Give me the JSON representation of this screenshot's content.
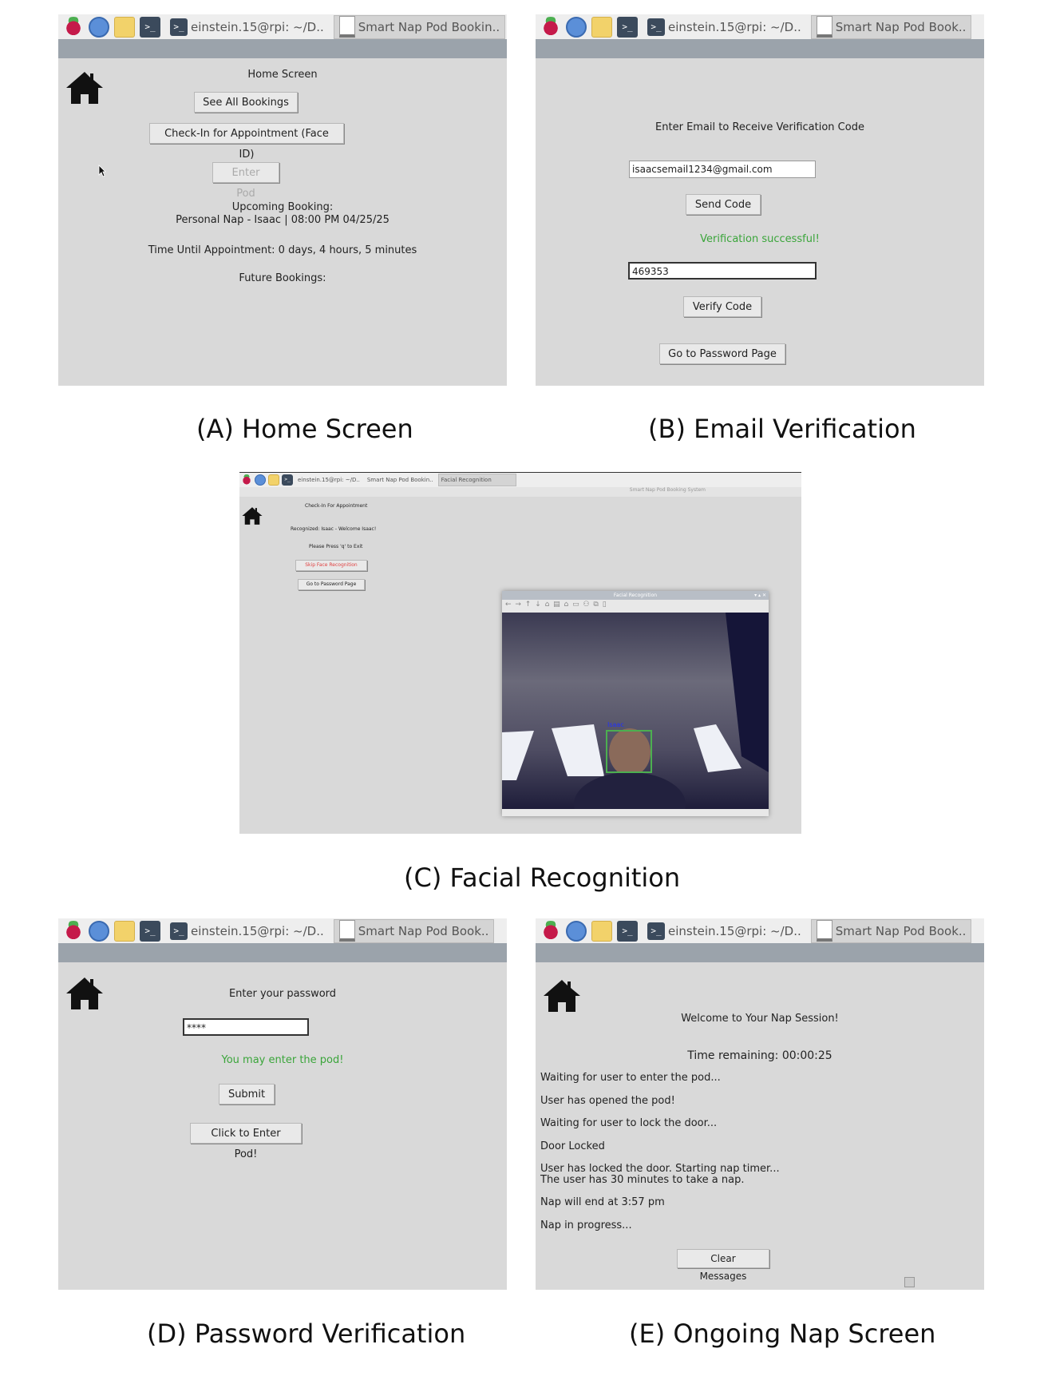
{
  "taskbar": {
    "terminal_glyph": ">_",
    "tasks": [
      "einstein.15@rpi: ~/D..",
      "Smart Nap Pod Bookin..",
      "Smart Nap Pod Book.."
    ],
    "task_c_terminal": "einstein.15@rpi: ~/D..",
    "task_c_app": "Smart Nap Pod Bookin..",
    "task_c_facial": "Facial Recognition",
    "app_window_title": "Smart Nap Pod Booking System"
  },
  "panel_a": {
    "heading": "Home Screen",
    "see_all": "See All Bookings",
    "checkin": "Check-In for Appointment (Face ID)",
    "enter_pod": "Enter Pod",
    "upcoming_label": "Upcoming Booking:",
    "upcoming_value": "Personal Nap - Isaac | 08:00 PM 04/25/25",
    "time_until": "Time Until Appointment: 0 days, 4 hours, 5 minutes",
    "future": "Future Bookings:"
  },
  "panel_b": {
    "heading": "Enter Email to Receive Verification Code",
    "email_value": "isaacsemail1234@gmail.com",
    "send_code": "Send Code",
    "status": "Verification successful!",
    "code_value": "469353",
    "verify_code": "Verify Code",
    "go_password": "Go to Password Page"
  },
  "panel_c": {
    "heading": "Check-In For Appointment",
    "recognized": "Recognized: Isaac - Welcome Isaac!",
    "press_q": "Please Press 'q' to Exit",
    "skip": "Skip Face Recognition",
    "go_password": "Go to Password Page",
    "popup_title": "Facial Recognition",
    "popup_controls": "▾ ▴ ✕",
    "toolbar_icons": "← → ↑ ↓ ⌂ ▤ ⌂ ▭ ⚇ ⧉ ▯",
    "face_label": "Isaac"
  },
  "panel_d": {
    "heading": "Enter your password",
    "password_value": "****",
    "status": "You may enter the pod!",
    "submit": "Submit",
    "enter": "Click to Enter Pod!"
  },
  "panel_e": {
    "heading": "Welcome to Your Nap Session!",
    "time_remaining": "Time remaining: 00:00:25",
    "messages": [
      "Waiting for user to enter the pod...",
      "User has opened the pod!",
      "Waiting for user to lock the door...",
      "Door Locked",
      "User has locked the door. Starting nap timer...",
      "The user has 30 minutes to take a nap.",
      "Nap will end at 3:57 pm",
      "Nap in progress..."
    ],
    "clear": "Clear Messages"
  },
  "captions": {
    "a": "(A)  Home Screen",
    "b": "(B)  Email Verification",
    "c": "(C) Facial Recognition",
    "d": "(D) Password Verification",
    "e": "(E)  Ongoing Nap Screen"
  }
}
